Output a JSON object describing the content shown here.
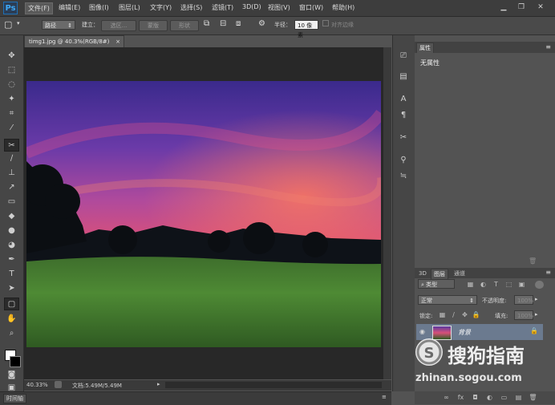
{
  "app": {
    "logo": "Ps"
  },
  "menu": [
    "文件(F)",
    "编辑(E)",
    "图像(I)",
    "图层(L)",
    "文字(Y)",
    "选择(S)",
    "滤镜(T)",
    "3D(D)",
    "视图(V)",
    "窗口(W)",
    "帮助(H)"
  ],
  "window_controls": {
    "minimize": "▁",
    "restore": "❐",
    "close": "✕"
  },
  "options": {
    "mode_value": "路径",
    "make_label": "建立：",
    "selection_btn": "选区...",
    "mask_btn": "蒙版",
    "shape_btn": "形状",
    "radius_label": "半径：",
    "radius_value": "10 像素",
    "align_edges": "对齐边缘"
  },
  "document": {
    "tab_title": "timg1.jpg @ 40.3%(RGB/8#)",
    "tab_close": "×",
    "zoom": "40.33%",
    "doc_info": "文档:5.49M/5.49M"
  },
  "timeline": {
    "label": "时间轴"
  },
  "properties_panel": {
    "title": "属性",
    "content": "无属性"
  },
  "layers_panel": {
    "tabs": [
      "3D",
      "图层",
      "通道"
    ],
    "filter_kind": "类型",
    "blend_mode": "正常",
    "opacity_label": "不透明度:",
    "opacity_value": "100%",
    "lock_label": "锁定:",
    "fill_label": "填充:",
    "fill_value": "100%",
    "layers": [
      {
        "name": "背景",
        "visible": true,
        "locked": true
      }
    ],
    "bottom_icons": [
      "link-icon",
      "fx-icon",
      "mask-icon",
      "adjustment-icon",
      "group-icon",
      "new-layer-icon",
      "delete-icon"
    ]
  },
  "watermark": {
    "brand": "搜狗指南",
    "url": "zhinan.sogou.com"
  },
  "colors": {
    "ps_blue": "#3fa9f5",
    "panel_bg": "#535353",
    "canvas_bg": "#282828",
    "selected_layer": "#6b7a8f"
  }
}
